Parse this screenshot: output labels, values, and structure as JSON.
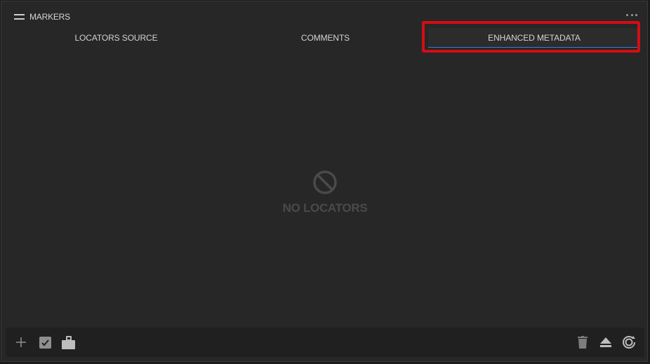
{
  "panel": {
    "title": "MARKERS",
    "menu_icon": "hamburger-icon",
    "more_icon": "more-horizontal-icon"
  },
  "tabs": [
    {
      "label": "LOCATORS SOURCE",
      "active": false
    },
    {
      "label": "COMMENTS",
      "active": false
    },
    {
      "label": "ENHANCED METADATA",
      "active": true
    }
  ],
  "empty_state": {
    "icon": "no-entry-icon",
    "message": "NO LOCATORS"
  },
  "footer": {
    "left_buttons": [
      "add-icon",
      "checkbox-icon",
      "clipboard-icon"
    ],
    "right_buttons": [
      "trash-icon",
      "eject-icon",
      "sync-icon"
    ]
  },
  "colors": {
    "background": "#272727",
    "active_tab_underline": "#3d7bd9",
    "highlight": "#d40d14",
    "empty_text": "#4a4a4a"
  }
}
